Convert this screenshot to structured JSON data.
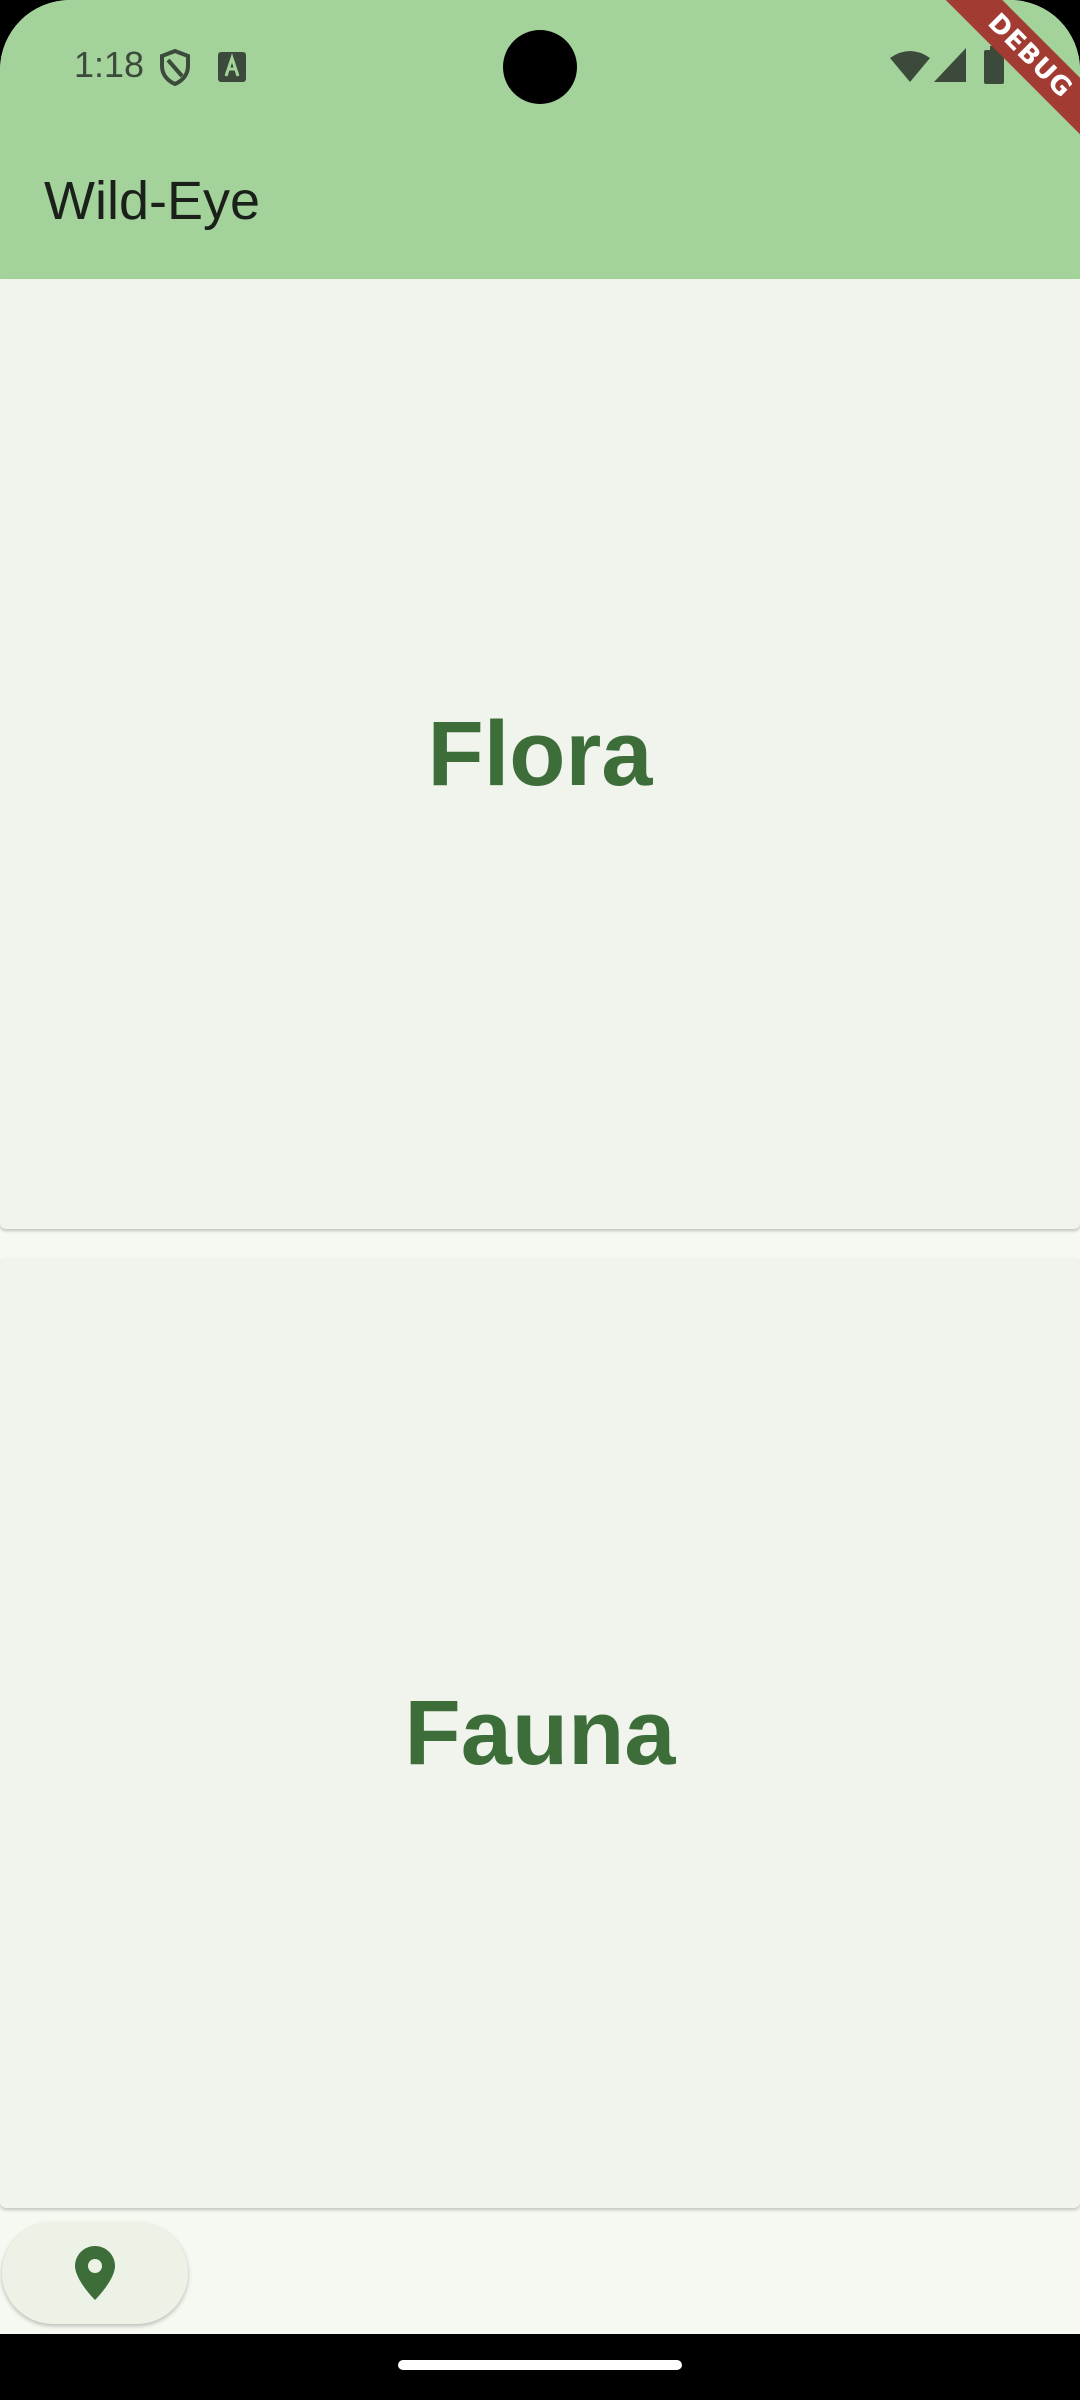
{
  "status_bar": {
    "time": "1:18",
    "icons_left": [
      "shield-icon",
      "text-a-icon"
    ],
    "icons_right": [
      "wifi-icon",
      "signal-icon",
      "battery-icon"
    ]
  },
  "app_bar": {
    "title": "Wild-Eye",
    "color": "#A3D39B"
  },
  "cards": [
    {
      "label": "Flora"
    },
    {
      "label": "Fauna"
    }
  ],
  "fab": {
    "icon": "location-pin-icon"
  },
  "debug_banner": {
    "text": "DEBUG"
  },
  "colors": {
    "accent": "#3D6E3A",
    "card_background": "#F0F4EC",
    "page_background": "#F6F9F1"
  }
}
